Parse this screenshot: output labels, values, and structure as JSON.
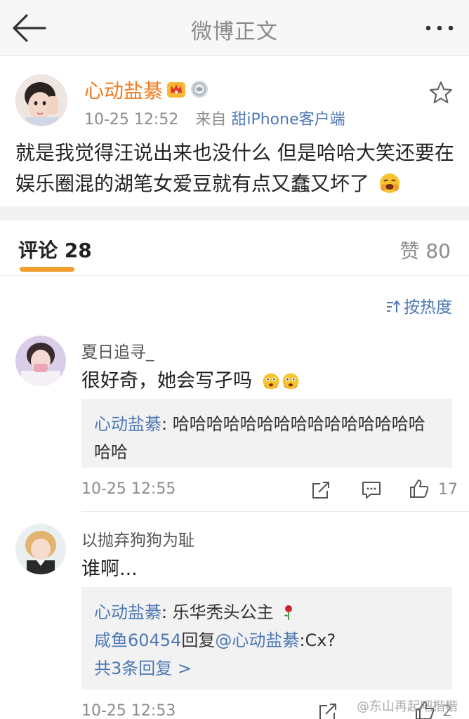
{
  "header": {
    "title": "微博正文"
  },
  "post": {
    "author": "心动盐綦",
    "time": "10-25 12:52",
    "source_prefix": "来自",
    "source": "甜iPhone客户端",
    "body": "就是我觉得汪说出来也没什么 但是哈哈大笑还要在娱乐圈混的湖笔女爱豆就有点又蠢又坏了",
    "icons": {
      "badge1": "crown-badge-icon",
      "badge2": "medal-badge-icon",
      "favorite": "star-icon"
    }
  },
  "tabs": {
    "comments_label": "评论",
    "comments_count": "28",
    "likes_label": "赞",
    "likes_count": "80"
  },
  "sort": {
    "label": "按热度"
  },
  "comments": [
    {
      "user": "夏日追寻_",
      "text": "很好奇，她会写孑吗",
      "reply": {
        "user": "心动盐綦",
        "text": "哈哈哈哈哈哈哈哈哈哈哈哈哈哈哈哈哈"
      },
      "time": "10-25 12:55",
      "likes": "17"
    },
    {
      "user": "以抛弃狗狗为耻",
      "text": "谁啊...",
      "replies": [
        {
          "user": "心动盐綦",
          "text": "乐华秃头公主"
        },
        {
          "user": "咸鱼60454",
          "mid": "回复",
          "mention": "@心动盐綦",
          "text": ":Cx?"
        }
      ],
      "more_replies": "共3条回复 >",
      "time": "10-25 12:53",
      "likes": "2"
    }
  ],
  "watermark": "@东山再起吧楷楷",
  "colors": {
    "accent_orange": "#f27a1a",
    "link_blue": "#4e78b4",
    "tab_underline": "#f0a030",
    "meta_gray": "#8c8c8c"
  }
}
